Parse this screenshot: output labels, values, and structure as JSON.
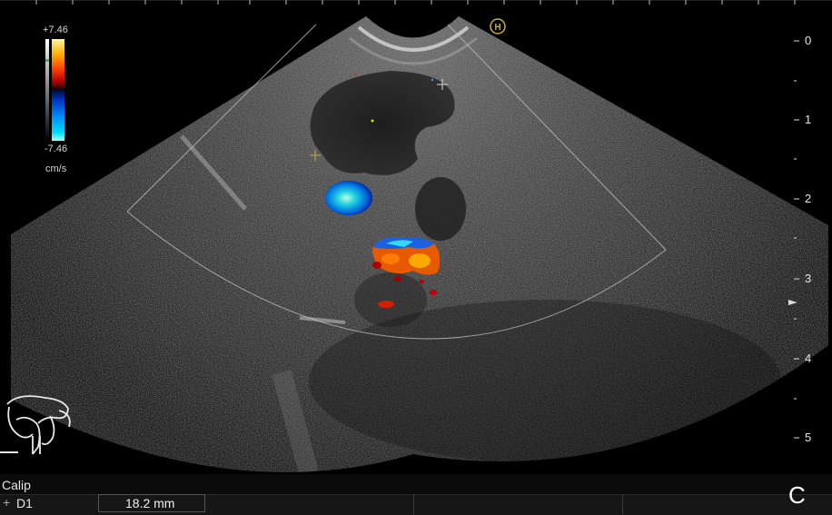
{
  "color_bar": {
    "max_label": "+7.46",
    "min_label": "-7.46",
    "unit_label": "cm/s",
    "positive_colors": [
      "#fff7a0",
      "#ffb000",
      "#ff5a00",
      "#c80000",
      "#300000"
    ],
    "negative_colors": [
      "#000830",
      "#0030c0",
      "#0090ff",
      "#00e0ff",
      "#a0fff0"
    ]
  },
  "depth_scale": {
    "unit": "cm",
    "max_depth": 5.3,
    "labels": [
      "0",
      "1",
      "2",
      "3",
      "4",
      "5"
    ],
    "focus_depth": 3.4
  },
  "orientation_marker": "H",
  "measurements": {
    "section_title": "Calip",
    "items": [
      {
        "marker": "+",
        "name": "D1",
        "value": "18.2 mm"
      }
    ]
  },
  "panel_letter": "C",
  "colors": {
    "background": "#000000",
    "text": "#e6e6e6",
    "marker_yellow": "#c8b040"
  }
}
